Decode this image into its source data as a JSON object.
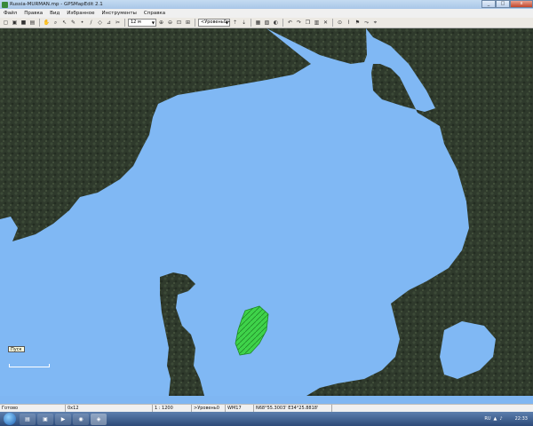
{
  "window": {
    "title": "Russia-MURMAN.mp - GPSMapEdit 2.1",
    "minimize": "_",
    "maximize": "□",
    "close": "x"
  },
  "menu": [
    "Файл",
    "Правка",
    "Вид",
    "Избранное",
    "Инструменты",
    "Справка"
  ],
  "toolbar": {
    "zoom": "12 м",
    "level": "<Уровень0>"
  },
  "map": {
    "tooltip": "Пуск"
  },
  "status": {
    "ready": "Готово",
    "type": "0x12",
    "scale": "1 : 1200",
    "level": ">Уровень0",
    "grid": "WM17",
    "coords": "N68°55.3003' E34°25.8818'"
  },
  "taskbar": {
    "lang": "RU",
    "time": "22:33"
  },
  "colors": {
    "water": "#80b8f4",
    "land": "#2f3a2c",
    "polygon": "#3fd34a"
  }
}
